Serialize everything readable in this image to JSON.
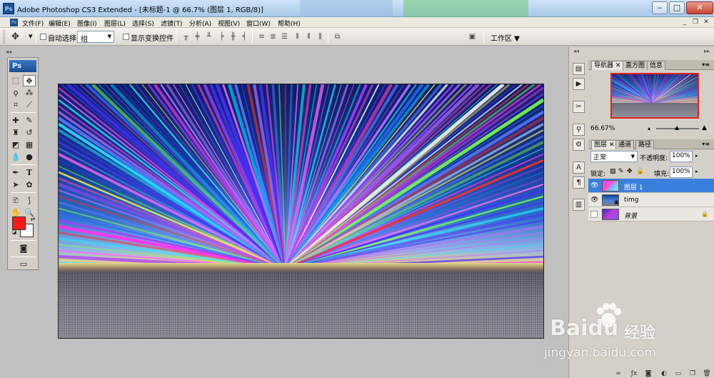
{
  "window": {
    "title": "Adobe Photoshop CS3 Extended - [未标题-1 @ 66.7% (图层 1, RGB/8)]",
    "app_icon": "Ps",
    "controls": [
      "minimize",
      "maximize",
      "close"
    ]
  },
  "mdi_controls": [
    "minimize",
    "restore",
    "close"
  ],
  "menu": [
    "文件(F)",
    "编辑(E)",
    "图像(I)",
    "图层(L)",
    "选择(S)",
    "滤镜(T)",
    "分析(A)",
    "视图(V)",
    "窗口(W)",
    "帮助(H)"
  ],
  "options": {
    "auto_select_label": "自动选择:",
    "auto_select_value": "组",
    "show_transform_label": "显示变换控件",
    "workspace_label": "工作区"
  },
  "toolbox": {
    "badge": "Ps",
    "tools": [
      "marquee",
      "move",
      "lasso",
      "magic-wand",
      "crop",
      "slice",
      "healing",
      "brush",
      "stamp",
      "history-brush",
      "eraser",
      "gradient",
      "blur",
      "dodge",
      "pen",
      "type",
      "path-select",
      "shape",
      "notes",
      "eyedropper",
      "hand",
      "zoom"
    ],
    "foreground_color": "#ff1a1a",
    "background_color": "#ffffff"
  },
  "panels": {
    "navigator_tabs": [
      "导航器",
      "直方图",
      "信息"
    ],
    "zoom_percent": "66.67%",
    "layer_tabs": [
      "图层",
      "通道",
      "路径"
    ],
    "blend_mode": "正常",
    "opacity_label": "不透明度:",
    "opacity_value": "100%",
    "lock_label": "锁定:",
    "fill_label": "填充:",
    "fill_value": "100%",
    "layers": [
      {
        "name": "图层 1",
        "selected": true,
        "visible": true,
        "locked": false
      },
      {
        "name": "timg",
        "selected": false,
        "visible": true,
        "locked": false
      },
      {
        "name": "背景",
        "selected": false,
        "visible": false,
        "locked": true
      }
    ]
  },
  "watermark": {
    "brand": "Baidu",
    "suffix": "经验",
    "url": "jingyan.baidu.com"
  },
  "colors": {
    "selected_layer": "#3b7fdd",
    "accent_red": "#e2231a"
  }
}
